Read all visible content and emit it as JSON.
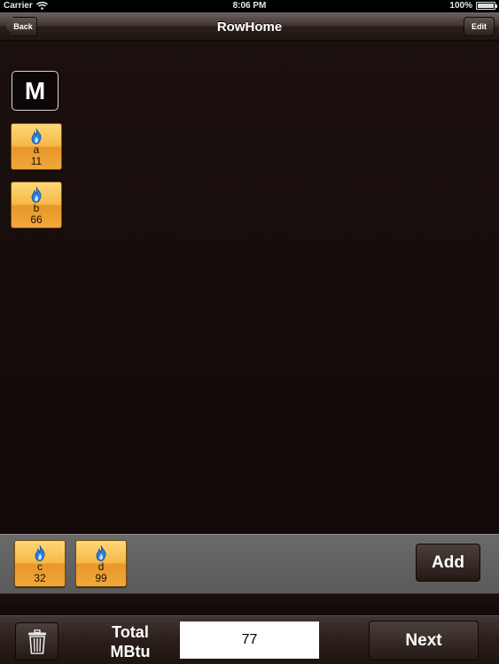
{
  "status_bar": {
    "carrier": "Carrier",
    "time": "8:06 PM",
    "battery": "100%"
  },
  "nav": {
    "back_label": "Back",
    "title": "RowHome",
    "edit_label": "Edit"
  },
  "main": {
    "header_letter": "M",
    "tiles": [
      {
        "name": "a",
        "value": "11"
      },
      {
        "name": "b",
        "value": "66"
      }
    ]
  },
  "tray": {
    "tiles": [
      {
        "name": "c",
        "value": "32"
      },
      {
        "name": "d",
        "value": "99"
      }
    ],
    "add_label": "Add"
  },
  "bottom": {
    "total_label": "Total MBtu",
    "total_value": "77",
    "next_label": "Next"
  },
  "icons": {
    "tile": "flame-icon",
    "trash": "trash-icon",
    "wifi": "wifi-icon",
    "battery": "battery-icon"
  },
  "colors": {
    "tile_top": "#fcd77a",
    "tile_bottom": "#e9962a",
    "flame": "#2a7fe0",
    "background": "#150b08"
  }
}
